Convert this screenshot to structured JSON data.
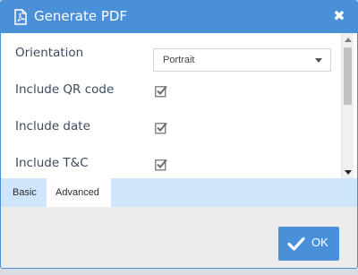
{
  "dialog": {
    "title": "Generate PDF",
    "title_icon": "pdf-file-icon",
    "close_icon": "close-icon",
    "close_symbol": "✖"
  },
  "form": {
    "orientation": {
      "label": "Orientation",
      "selected": "Portrait"
    },
    "include_qr": {
      "label": "Include QR code",
      "checked": true
    },
    "include_date": {
      "label": "Include date",
      "checked": true
    },
    "include_tc": {
      "label": "Include T&C",
      "checked": true
    }
  },
  "tabs": [
    {
      "label": "Basic",
      "active": false
    },
    {
      "label": "Advanced",
      "active": true
    }
  ],
  "footer": {
    "ok_label": "OK",
    "ok_icon": "checkmark-icon"
  },
  "colors": {
    "accent": "#4a90d9",
    "tabbar": "#cfe5fb",
    "footer": "#ececec"
  }
}
